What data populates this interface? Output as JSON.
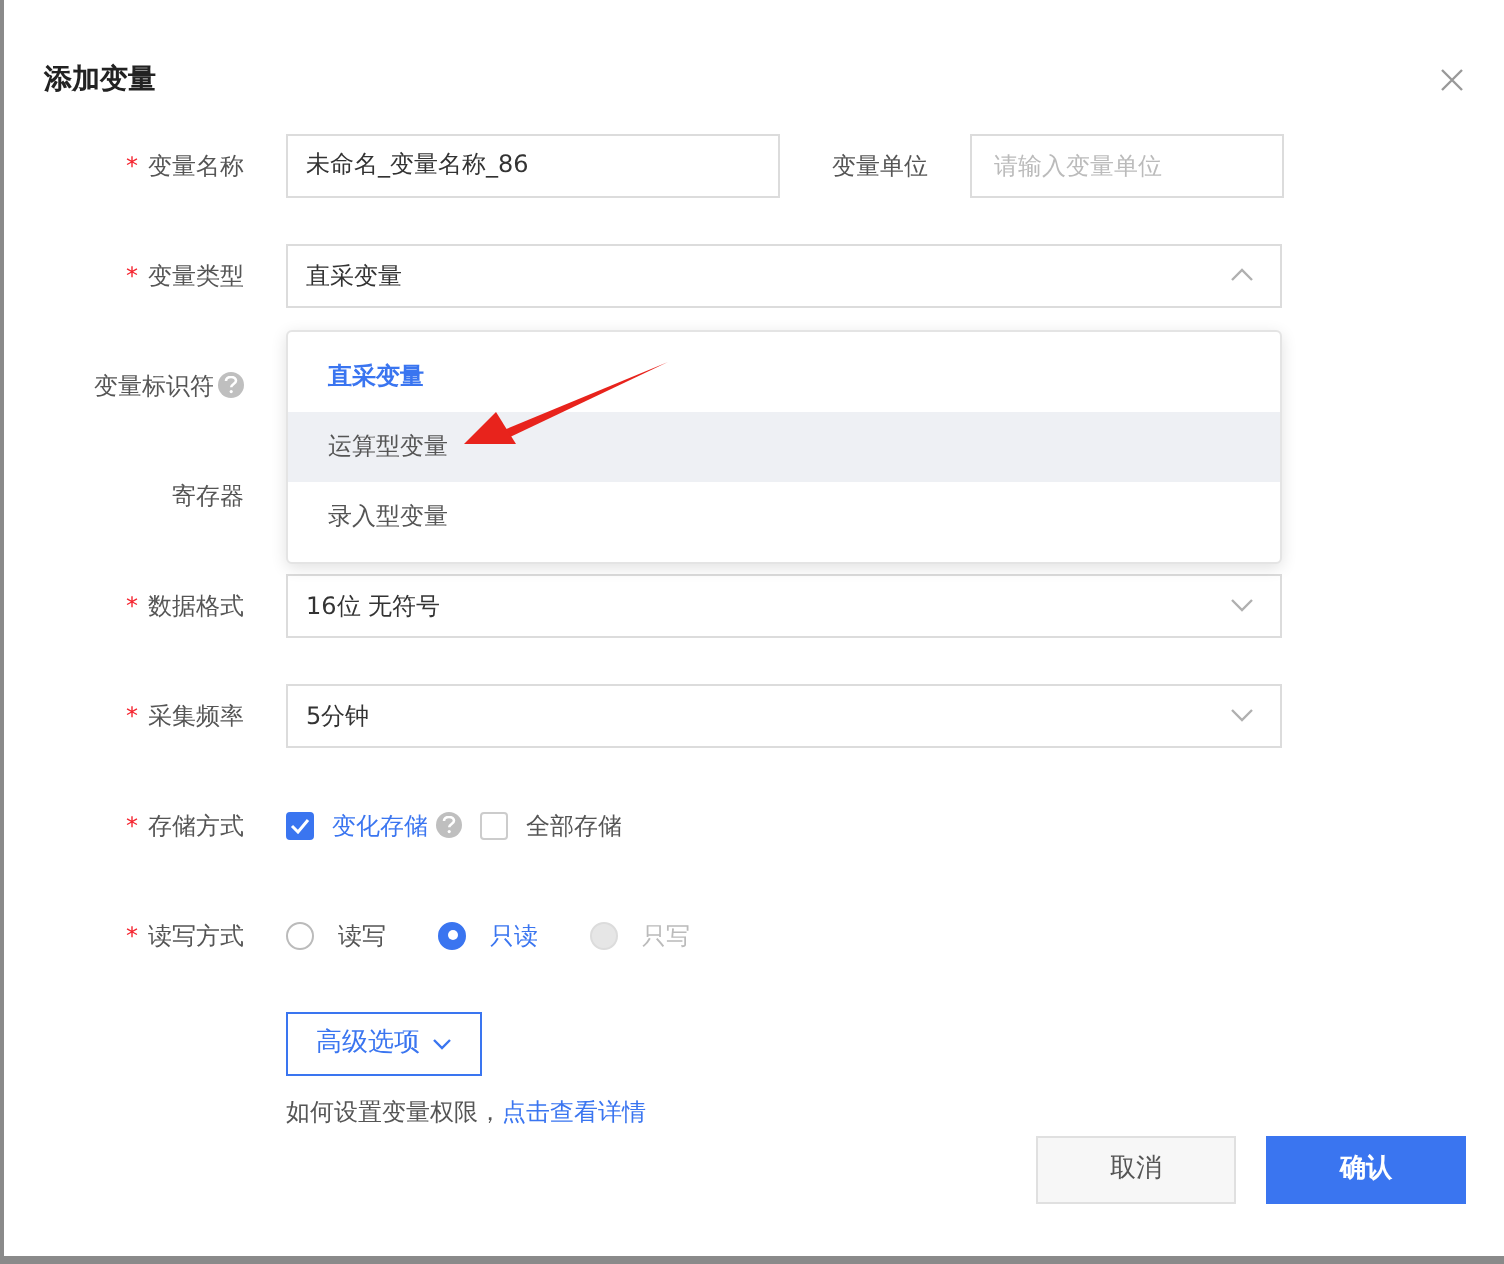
{
  "dialog": {
    "title": "添加变量"
  },
  "rows": [
    {
      "kind": "input_pair",
      "mark": "*",
      "label": "变量名称",
      "value": "未命名_变量名称_86",
      "side_label": "变量单位",
      "side_placeholder": "请输入变量单位"
    },
    {
      "kind": "select",
      "mark": "*",
      "label": "变量类型",
      "value": "直采变量",
      "expanded": true
    },
    {
      "kind": "covered",
      "label": "变量标识符",
      "help": true
    },
    {
      "kind": "covered",
      "label": "寄存器"
    },
    {
      "kind": "select",
      "mark": "*",
      "label": "数据格式",
      "value": "16位 无符号",
      "expanded": false
    },
    {
      "kind": "select",
      "mark": "*",
      "label": "采集频率",
      "value": "5分钟",
      "expanded": false
    },
    {
      "kind": "checkboxes",
      "mark": "*",
      "label": "存储方式",
      "options": [
        {
          "label": "变化存储",
          "checked": true,
          "help": true
        },
        {
          "label": "全部存储",
          "checked": false
        }
      ]
    },
    {
      "kind": "radios",
      "mark": "*",
      "label": "读写方式",
      "options": [
        {
          "label": "读写",
          "selected": false,
          "disabled": false
        },
        {
          "label": "只读",
          "selected": true,
          "disabled": false
        },
        {
          "label": "只写",
          "selected": false,
          "disabled": true
        }
      ]
    }
  ],
  "dropdown": {
    "options": [
      {
        "label": "直采变量",
        "selected": true,
        "highlighted": false
      },
      {
        "label": "运算型变量",
        "selected": false,
        "highlighted": true
      },
      {
        "label": "录入型变量",
        "selected": false,
        "highlighted": false
      }
    ]
  },
  "advanced": {
    "label": "高级选项"
  },
  "help": {
    "text": "如何设置变量权限，",
    "link": "点击查看详情"
  },
  "buttons": [
    {
      "kind": "secondary",
      "label": "取消"
    },
    {
      "kind": "primary",
      "label": "确认"
    }
  ]
}
